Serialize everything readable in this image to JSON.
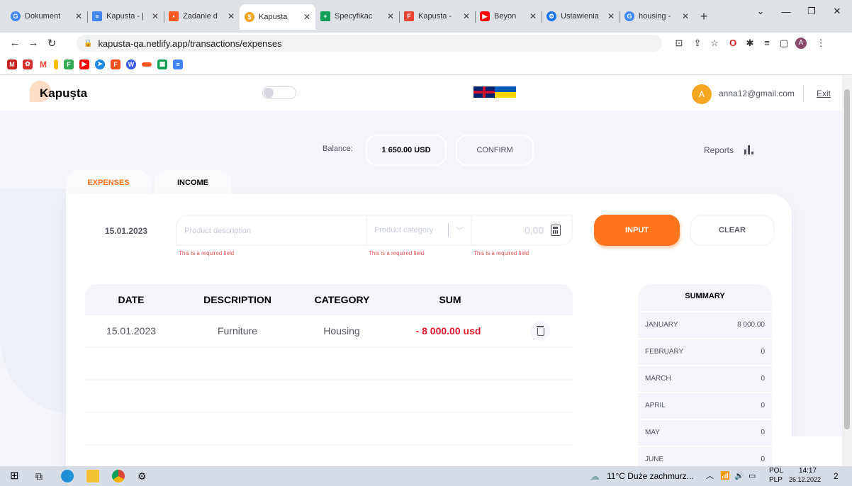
{
  "browser": {
    "tabs": [
      {
        "title": "Dokument",
        "icon_color": "#4285f4",
        "active": false
      },
      {
        "title": "Kapusta - |",
        "icon_color": "#4285f4",
        "active": false
      },
      {
        "title": "Zadanie d",
        "icon_color": "#ff5722",
        "active": false
      },
      {
        "title": "Kapusta",
        "icon_color": "#f5a623",
        "active": true
      },
      {
        "title": "Specyfikac",
        "icon_color": "#0f9d58",
        "active": false
      },
      {
        "title": "Kapusta -",
        "icon_color": "#ea4335",
        "active": false
      },
      {
        "title": "Beyon",
        "icon_color": "#ff0000",
        "active": false
      },
      {
        "title": "Ustawienia",
        "icon_color": "#1a73e8",
        "active": false
      },
      {
        "title": "housing -",
        "icon_color": "#4285f4",
        "active": false
      }
    ],
    "url": "kapusta-qa.netlify.app/transactions/expenses",
    "profile_initial": "A"
  },
  "header": {
    "logo_text": "Kapușta",
    "avatar_initial": "A",
    "email": "anna12@gmail.com",
    "exit_label": "Exit"
  },
  "balance": {
    "label": "Balance:",
    "value": "1 650.00 USD",
    "confirm_label": "CONFIRM",
    "reports_label": "Reports"
  },
  "tabs": {
    "expenses": "EXPENSES",
    "income": "INCOME"
  },
  "form": {
    "date": "15.01.2023",
    "description_placeholder": "Product description",
    "category_placeholder": "Product category",
    "amount_placeholder": "0,00",
    "error_text": "This is a required field",
    "input_label": "INPUT",
    "clear_label": "CLEAR"
  },
  "table": {
    "headers": [
      "DATE",
      "DESCRIPTION",
      "CATEGORY",
      "SUM"
    ],
    "rows": [
      {
        "date": "15.01.2023",
        "description": "Furniture",
        "category": "Housing",
        "sum": "- 8 000.00 usd"
      }
    ]
  },
  "summary": {
    "title": "SUMMARY",
    "months": [
      {
        "name": "JANUARY",
        "value": "8 000.00"
      },
      {
        "name": "FEBRUARY",
        "value": "0"
      },
      {
        "name": "MARCH",
        "value": "0"
      },
      {
        "name": "APRIL",
        "value": "0"
      },
      {
        "name": "MAY",
        "value": "0"
      },
      {
        "name": "JUNE",
        "value": "0"
      }
    ]
  },
  "taskbar": {
    "weather": "11°C  Duże zachmurz...",
    "lang": "POL",
    "lang2": "PLP",
    "time": "14:17",
    "date": "26.12.2022",
    "notifications": "2"
  },
  "colors": {
    "accent": "#ff751d",
    "sum_red": "#e7192e",
    "error_red": "#eb5757"
  }
}
